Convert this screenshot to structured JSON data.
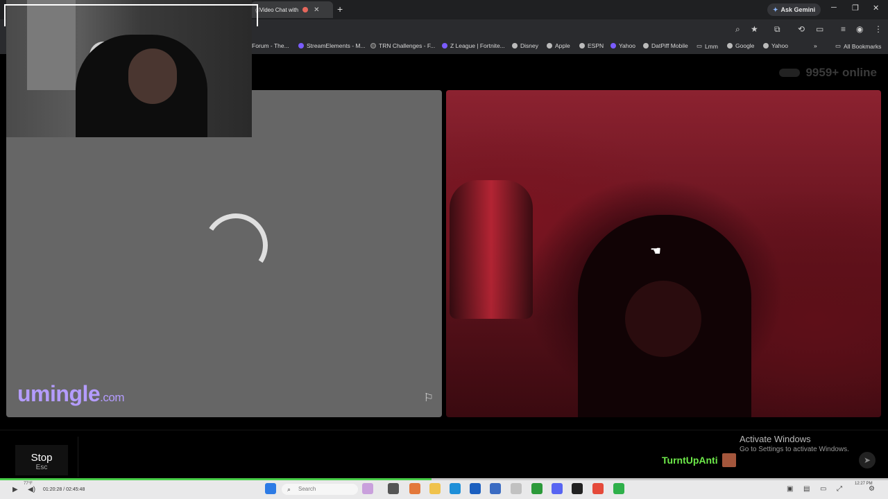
{
  "browser": {
    "tab_title": "Video Chat with",
    "tab_title_prefix": "gl",
    "new_tab": "+",
    "ask_gemini": "Ask Gemini",
    "window": {
      "minimize": "─",
      "restore": "❐",
      "close": "✕"
    }
  },
  "bookmarks": [
    {
      "label": "Forum - The...",
      "icon": "none"
    },
    {
      "label": "StreamElements - M...",
      "icon": "purple"
    },
    {
      "label": "TRN Challenges - F...",
      "icon": "dark"
    },
    {
      "label": "Z League | Fortnite...",
      "icon": "purple"
    },
    {
      "label": "Disney",
      "icon": "globe"
    },
    {
      "label": "Apple",
      "icon": "globe"
    },
    {
      "label": "ESPN",
      "icon": "globe"
    },
    {
      "label": "Yahoo",
      "icon": "purple"
    },
    {
      "label": "DatPiff Mobile",
      "icon": "globe"
    },
    {
      "label": "Lmm",
      "icon": "folder"
    },
    {
      "label": "Google",
      "icon": "globe"
    },
    {
      "label": "Yahoo",
      "icon": "globe"
    }
  ],
  "bookmarks_more": "»",
  "all_bookmarks": "All Bookmarks",
  "page": {
    "online_count": "9959+ online",
    "logo_main": "umingle",
    "logo_domain": ".com",
    "stop_label": "Stop",
    "stop_hint": "Esc",
    "username": "TurntUpAnti",
    "activate_title": "Activate Windows",
    "activate_sub": "Go to Settings to activate Windows."
  },
  "player": {
    "time": "01:20:28 / 02:45:48",
    "temp": "77°F",
    "search_placeholder": "Search",
    "clock": "12:27 PM",
    "progress_fraction": 0.486
  },
  "colors": {
    "logo": "#b49cff",
    "username": "#6eea4a",
    "progress": "#4ad04a"
  }
}
